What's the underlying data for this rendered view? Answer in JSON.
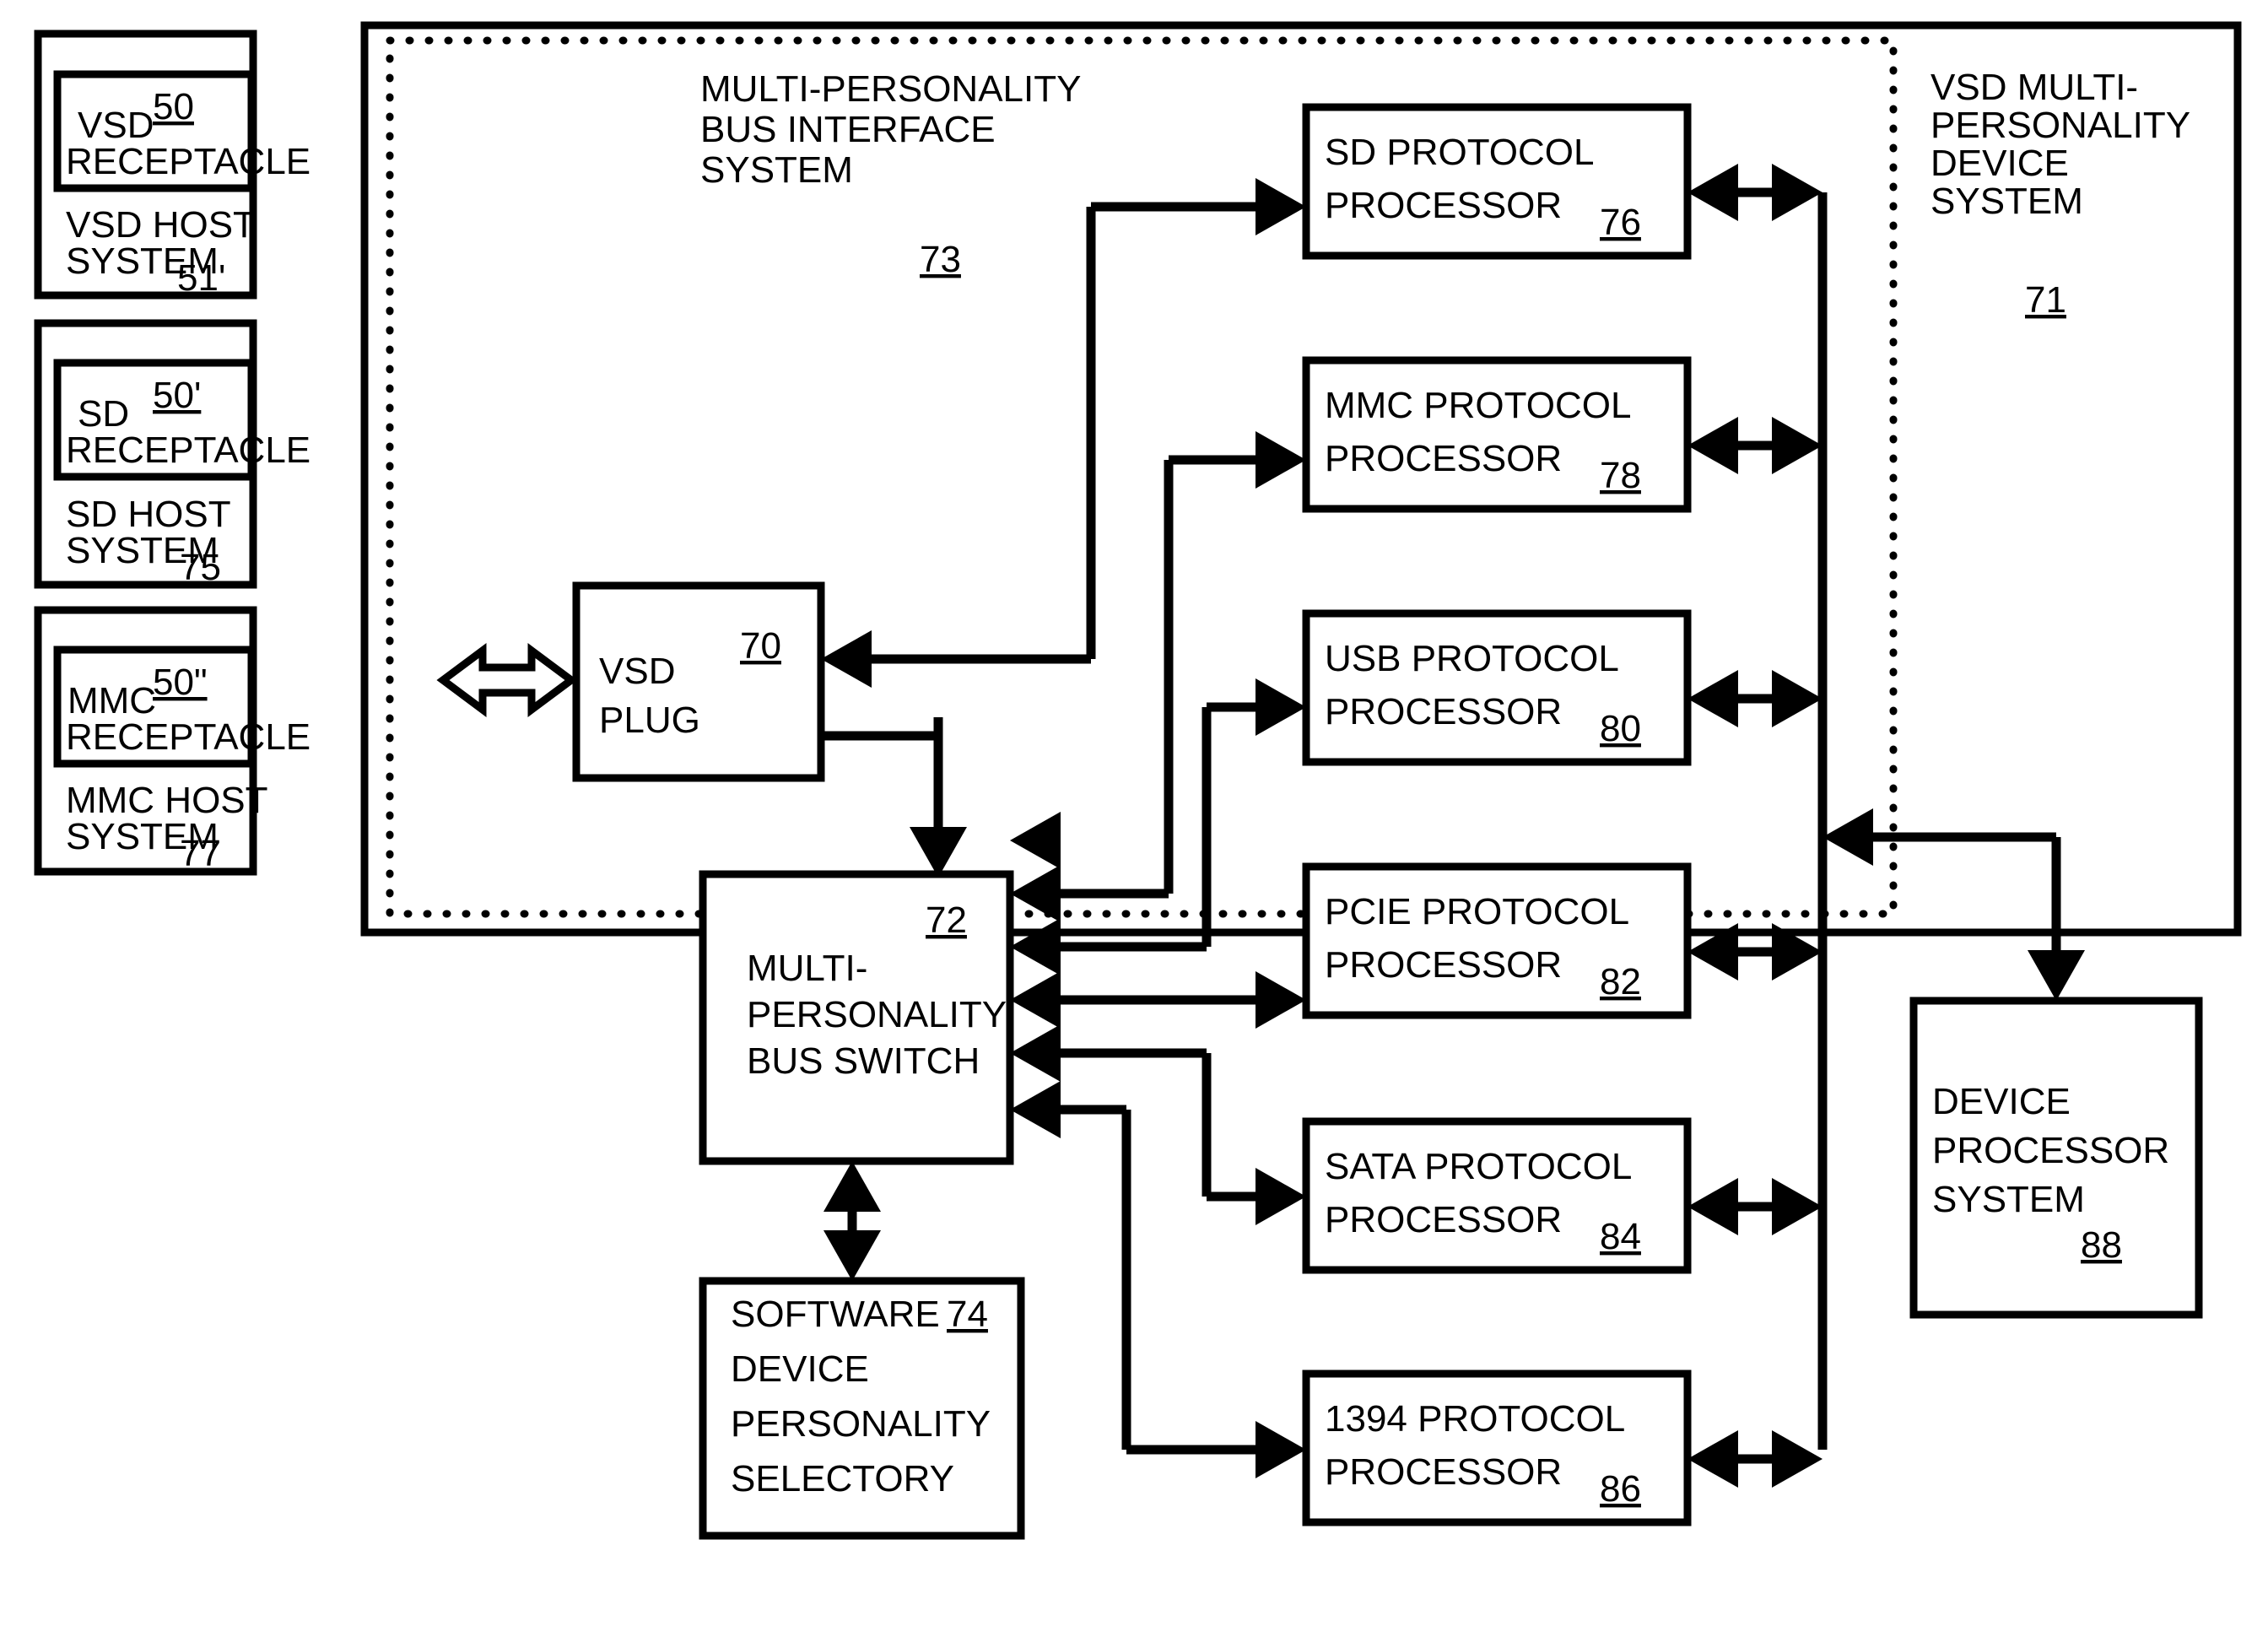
{
  "figure": {
    "type": "patent-block-diagram",
    "background_color": "#ffffff",
    "line_color": "#000000"
  },
  "host_systems": [
    {
      "receptacle_label": "VSD\nRECEPTACLE",
      "receptacle_line1": "VSD",
      "receptacle_line2": "RECEPTACLE",
      "receptacle_ref": "50",
      "host_line1": "VSD HOST",
      "host_line2": "SYSTEM",
      "host_ref": "51'"
    },
    {
      "receptacle_label": "SD\nRECEPTACLE",
      "receptacle_line1": "SD",
      "receptacle_line2": "RECEPTACLE",
      "receptacle_ref": "50'",
      "host_line1": "SD HOST",
      "host_line2": "SYSTEM",
      "host_ref": "75"
    },
    {
      "receptacle_label": "MMC\nRECEPTACLE",
      "receptacle_line1": "MMC",
      "receptacle_line2": "RECEPTACLE",
      "receptacle_ref": "50\"",
      "host_line1": "MMC HOST",
      "host_line2": "SYSTEM",
      "host_ref": "77"
    }
  ],
  "device_system": {
    "title_line1": "VSD MULTI-",
    "title_line2": "PERSONALITY",
    "title_line3": "DEVICE",
    "title_line4": "SYSTEM",
    "ref": "71"
  },
  "bus_interface_system": {
    "title_line1": "MULTI-PERSONALITY",
    "title_line2": "BUS INTERFACE",
    "title_line3": "SYSTEM",
    "ref": "73"
  },
  "plug": {
    "line1": "VSD",
    "line2": "PLUG",
    "ref": "70"
  },
  "bus_switch": {
    "line1": "MULTI-",
    "line2": "PERSONALITY",
    "line3": "BUS SWITCH",
    "ref": "72"
  },
  "selectory": {
    "line1": "SOFTWARE",
    "line2": "DEVICE",
    "line3": "PERSONALITY",
    "line4": "SELECTORY",
    "ref": "74"
  },
  "device_processor": {
    "line1": "DEVICE",
    "line2": "PROCESSOR",
    "line3": "SYSTEM",
    "ref": "88"
  },
  "protocol_processors": [
    {
      "line1": "SD PROTOCOL",
      "line2": "PROCESSOR",
      "ref": "76"
    },
    {
      "line1": "MMC PROTOCOL",
      "line2": "PROCESSOR",
      "ref": "78"
    },
    {
      "line1": "USB PROTOCOL",
      "line2": "PROCESSOR",
      "ref": "80"
    },
    {
      "line1": "PCIE PROTOCOL",
      "line2": "PROCESSOR",
      "ref": "82"
    },
    {
      "line1": "SATA PROTOCOL",
      "line2": "PROCESSOR",
      "ref": "84"
    },
    {
      "line1": "1394 PROTOCOL",
      "line2": "PROCESSOR",
      "ref": "86"
    }
  ],
  "icons": {
    "bidirectional_host_link": "double-arrow-icon"
  }
}
